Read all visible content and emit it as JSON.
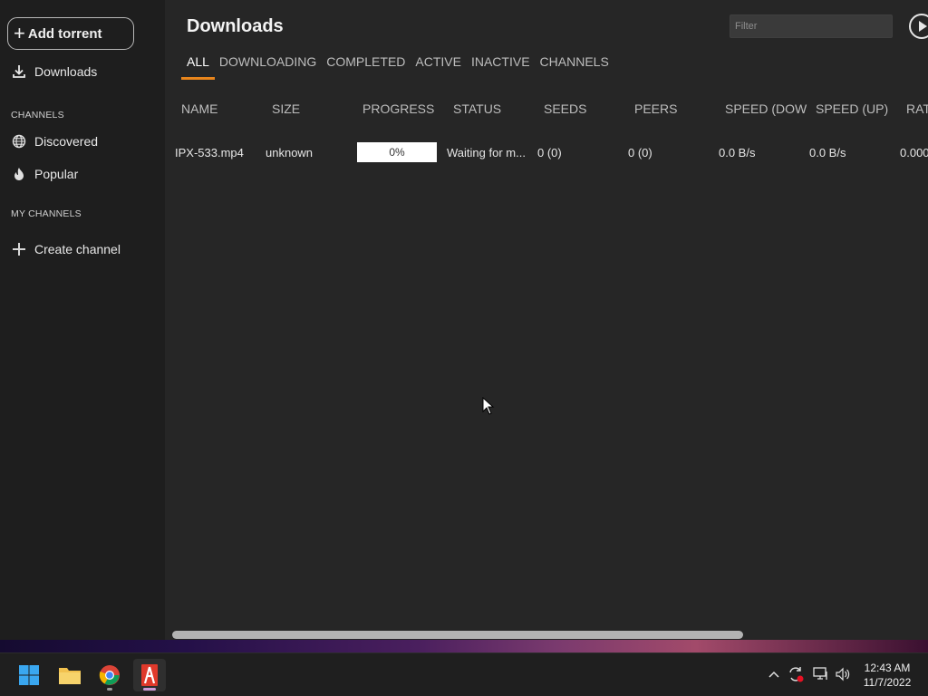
{
  "sidebar": {
    "add_torrent_label": "Add torrent",
    "downloads_label": "Downloads",
    "channels_section": "CHANNELS",
    "discovered_label": "Discovered",
    "popular_label": "Popular",
    "my_channels_section": "MY CHANNELS",
    "create_channel_label": "Create channel"
  },
  "main": {
    "title": "Downloads",
    "filter_placeholder": "Filter",
    "tabs": [
      {
        "label": "ALL",
        "active": true
      },
      {
        "label": "DOWNLOADING"
      },
      {
        "label": "COMPLETED"
      },
      {
        "label": "ACTIVE"
      },
      {
        "label": "INACTIVE"
      },
      {
        "label": "CHANNELS"
      }
    ]
  },
  "table": {
    "columns": [
      "NAME",
      "SIZE",
      "PROGRESS",
      "STATUS",
      "SEEDS",
      "PEERS",
      "SPEED (DOW",
      "SPEED (UP)",
      "RAT"
    ],
    "rows": [
      {
        "name": "IPX-533.mp4",
        "size": "unknown",
        "progress": "0%",
        "progress_value": 0,
        "status": "Waiting for m...",
        "seeds": "0 (0)",
        "peers": "0 (0)",
        "speed_down": "0.0 B/s",
        "speed_up": "0.0 B/s",
        "ratio": "0.000"
      }
    ]
  },
  "taskbar": {
    "apps": [
      "windows-start",
      "file-explorer",
      "chrome",
      "tribler"
    ],
    "time": "12:43 AM",
    "date": "11/7/2022"
  },
  "colors": {
    "accent": "#e8851c",
    "sidebar_bg": "#1e1e1e",
    "main_bg": "#262626"
  }
}
